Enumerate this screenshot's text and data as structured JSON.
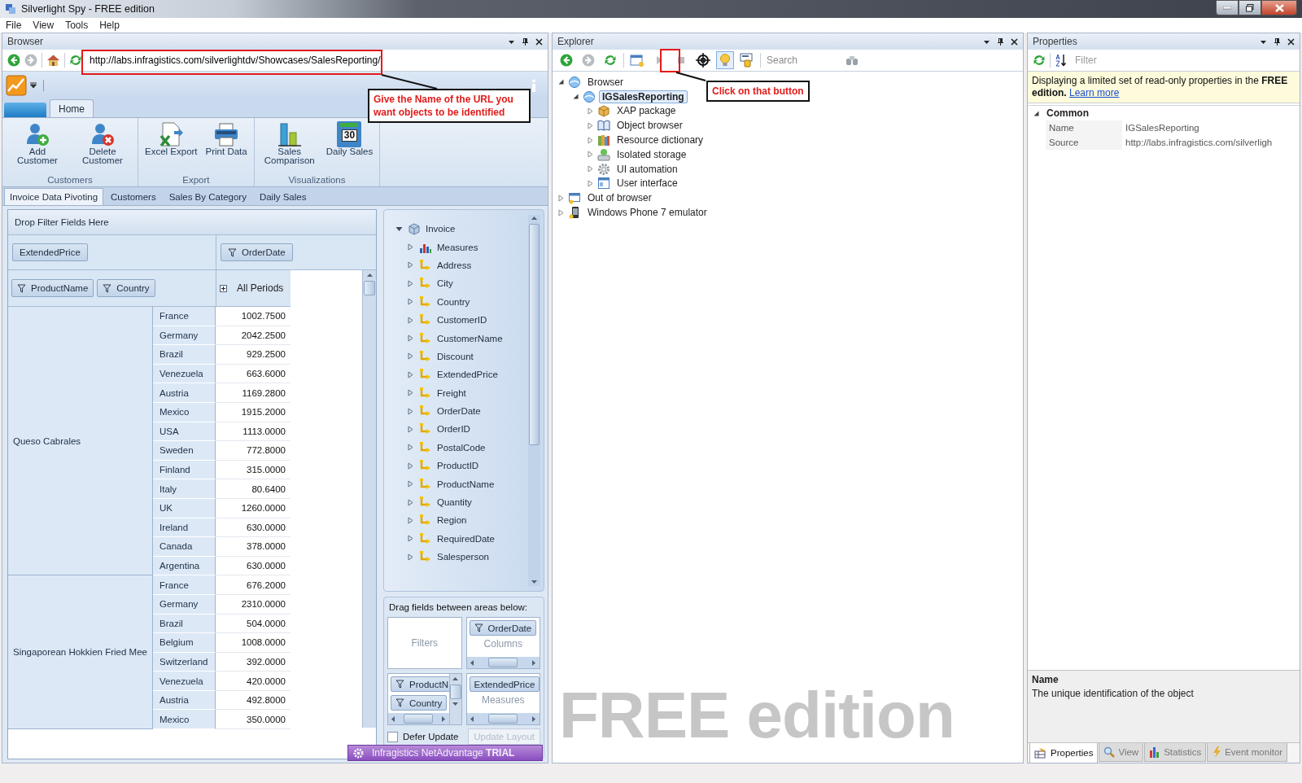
{
  "window": {
    "title": "Silverlight Spy - FREE edition"
  },
  "menu": [
    "File",
    "View",
    "Tools",
    "Help"
  ],
  "browser": {
    "title": "Browser",
    "address": "http://labs.infragistics.com/silverlightdv/Showcases/SalesReporting/",
    "toolbar": [
      {
        "kind": "back",
        "disabled": false
      },
      {
        "kind": "forward",
        "disabled": true
      },
      {
        "kind": "home",
        "disabled": false
      },
      {
        "kind": "refresh",
        "disabled": false
      }
    ]
  },
  "silverlight_app": {
    "ribbon_tabs": [
      {
        "label": "Home",
        "selected": true
      }
    ],
    "ribbon_groups": [
      {
        "label": "Customers",
        "buttons": [
          {
            "label": "Add Customer",
            "kind": "add-user"
          },
          {
            "label": "Delete Customer",
            "kind": "delete-user"
          }
        ]
      },
      {
        "label": "Export",
        "buttons": [
          {
            "label": "Excel Export",
            "kind": "excel"
          },
          {
            "label": "Print Data",
            "kind": "print"
          }
        ]
      },
      {
        "label": "Visualizations",
        "buttons": [
          {
            "label": "Sales Comparison",
            "kind": "chart"
          },
          {
            "label": "Daily Sales",
            "kind": "calendar",
            "badge": "30"
          }
        ]
      }
    ],
    "document_tabs": [
      {
        "label": "Invoice Data Pivoting",
        "selected": true
      },
      {
        "label": "Customers",
        "selected": false
      },
      {
        "label": "Sales By Category",
        "selected": false
      },
      {
        "label": "Daily Sales",
        "selected": false
      }
    ],
    "pivot": {
      "filter_area": "Drop Filter Fields Here",
      "measure": "ExtendedPrice",
      "column_field": "OrderDate",
      "row_fields": [
        "ProductName",
        "Country"
      ],
      "column_header": "All Periods",
      "groups": [
        {
          "product": "Queso Cabrales",
          "rows": [
            {
              "country": "France",
              "value": "1002.7500"
            },
            {
              "country": "Germany",
              "value": "2042.2500"
            },
            {
              "country": "Brazil",
              "value": "929.2500"
            },
            {
              "country": "Venezuela",
              "value": "663.6000"
            },
            {
              "country": "Austria",
              "value": "1169.2800"
            },
            {
              "country": "Mexico",
              "value": "1915.2000"
            },
            {
              "country": "USA",
              "value": "1113.0000"
            },
            {
              "country": "Sweden",
              "value": "772.8000"
            },
            {
              "country": "Finland",
              "value": "315.0000"
            },
            {
              "country": "Italy",
              "value": "80.6400"
            },
            {
              "country": "UK",
              "value": "1260.0000"
            },
            {
              "country": "Ireland",
              "value": "630.0000"
            },
            {
              "country": "Canada",
              "value": "378.0000"
            },
            {
              "country": "Argentina",
              "value": "630.0000"
            }
          ]
        },
        {
          "product": "Singaporean Hokkien Fried Mee",
          "rows": [
            {
              "country": "France",
              "value": "676.2000"
            },
            {
              "country": "Germany",
              "value": "2310.0000"
            },
            {
              "country": "Brazil",
              "value": "504.0000"
            },
            {
              "country": "Belgium",
              "value": "1008.0000"
            },
            {
              "country": "Switzerland",
              "value": "392.0000"
            },
            {
              "country": "Venezuela",
              "value": "420.0000"
            },
            {
              "country": "Austria",
              "value": "492.8000"
            },
            {
              "country": "Mexico",
              "value": "350.0000"
            }
          ]
        }
      ]
    },
    "field_list": [
      {
        "label": "Invoice",
        "kind": "cube",
        "expanded": true,
        "children": [
          {
            "label": "Measures",
            "kind": "measures",
            "expanded": false
          },
          {
            "label": "Address",
            "kind": "dimension",
            "expanded": false
          },
          {
            "label": "City",
            "kind": "dimension",
            "expanded": false
          },
          {
            "label": "Country",
            "kind": "dimension",
            "expanded": false
          },
          {
            "label": "CustomerID",
            "kind": "dimension",
            "expanded": false
          },
          {
            "label": "CustomerName",
            "kind": "dimension",
            "expanded": false
          },
          {
            "label": "Discount",
            "kind": "dimension",
            "expanded": false
          },
          {
            "label": "ExtendedPrice",
            "kind": "dimension",
            "expanded": false
          },
          {
            "label": "Freight",
            "kind": "dimension",
            "expanded": false
          },
          {
            "label": "OrderDate",
            "kind": "dimension",
            "expanded": false
          },
          {
            "label": "OrderID",
            "kind": "dimension",
            "expanded": false
          },
          {
            "label": "PostalCode",
            "kind": "dimension",
            "expanded": false
          },
          {
            "label": "ProductID",
            "kind": "dimension",
            "expanded": false
          },
          {
            "label": "ProductName",
            "kind": "dimension",
            "expanded": false
          },
          {
            "label": "Quantity",
            "kind": "dimension",
            "expanded": false
          },
          {
            "label": "Region",
            "kind": "dimension",
            "expanded": false
          },
          {
            "label": "RequiredDate",
            "kind": "dimension",
            "expanded": false
          },
          {
            "label": "Salesperson",
            "kind": "dimension",
            "expanded": false
          }
        ]
      }
    ],
    "areas": {
      "title": "Drag fields between areas below:",
      "filters": "Filters",
      "columns": "Columns",
      "column_fields": [
        "OrderDate"
      ],
      "row_fields": [
        "ProductN",
        "Country"
      ],
      "measures": "Measures",
      "measure_fields": [
        "ExtendedPrice"
      ],
      "defer_update": {
        "label": "Defer Update",
        "checked": false
      },
      "update_button": "Update Layout"
    },
    "trial_banner": "Infragistics NetAdvantage **TRIAL**"
  },
  "explorer": {
    "title": "Explorer",
    "search_placeholder": "Search",
    "toolbar": [
      {
        "kind": "back",
        "disabled": false,
        "on": false
      },
      {
        "kind": "forward",
        "disabled": true,
        "on": false
      },
      {
        "kind": "refresh",
        "disabled": false,
        "on": false
      },
      {
        "kind": "window",
        "disabled": false,
        "on": false
      },
      {
        "kind": "play",
        "disabled": true,
        "on": false
      },
      {
        "kind": "stop",
        "disabled": true,
        "on": false
      },
      {
        "kind": "target",
        "disabled": false,
        "on": false
      },
      {
        "kind": "bulb",
        "disabled": false,
        "on": true
      },
      {
        "kind": "tools",
        "disabled": false,
        "on": false
      }
    ],
    "tree": [
      {
        "label": "Browser",
        "kind": "browser",
        "expanded": true,
        "selected": false,
        "children": [
          {
            "label": "IGSalesReporting",
            "kind": "app",
            "expanded": true,
            "selected": true,
            "children": [
              {
                "label": "XAP package",
                "kind": "package",
                "expanded": false,
                "selected": false
              },
              {
                "label": "Object browser",
                "kind": "book",
                "expanded": false,
                "selected": false
              },
              {
                "label": "Resource dictionary",
                "kind": "resources",
                "expanded": false,
                "selected": false
              },
              {
                "label": "Isolated storage",
                "kind": "storage",
                "expanded": false,
                "selected": false
              },
              {
                "label": "UI automation",
                "kind": "gear",
                "expanded": false,
                "selected": false
              },
              {
                "label": "User interface",
                "kind": "form",
                "expanded": false,
                "selected": false
              }
            ]
          }
        ]
      },
      {
        "label": "Out of browser",
        "kind": "window",
        "expanded": false,
        "selected": false
      },
      {
        "label": "Windows Phone 7 emulator",
        "kind": "phone",
        "expanded": false,
        "selected": false
      }
    ],
    "watermark": "FREE edition"
  },
  "properties": {
    "title": "Properties",
    "filter_placeholder": "Filter",
    "notice": "Displaying a limited set of read-only properties in the **FREE edition.**",
    "notice_link": "Learn more",
    "category": {
      "label": "Common",
      "expanded": true,
      "rows": [
        {
          "name": "Name",
          "value": "IGSalesReporting"
        },
        {
          "name": "Source",
          "value": "http://labs.infragistics.com/silverligh"
        }
      ]
    },
    "description": {
      "title": "Name",
      "text": "The unique identification of the object"
    },
    "tabs": [
      {
        "label": "Properties",
        "kind": "properties",
        "selected": true
      },
      {
        "label": "View",
        "kind": "view",
        "selected": false
      },
      {
        "label": "Statistics",
        "kind": "statistics",
        "selected": false
      },
      {
        "label": "Event monitor",
        "kind": "events",
        "selected": false
      }
    ]
  },
  "annotations": [
    {
      "text": "Give the Name of the URL you want objects to be identified"
    },
    {
      "text": "Click on that button"
    }
  ]
}
